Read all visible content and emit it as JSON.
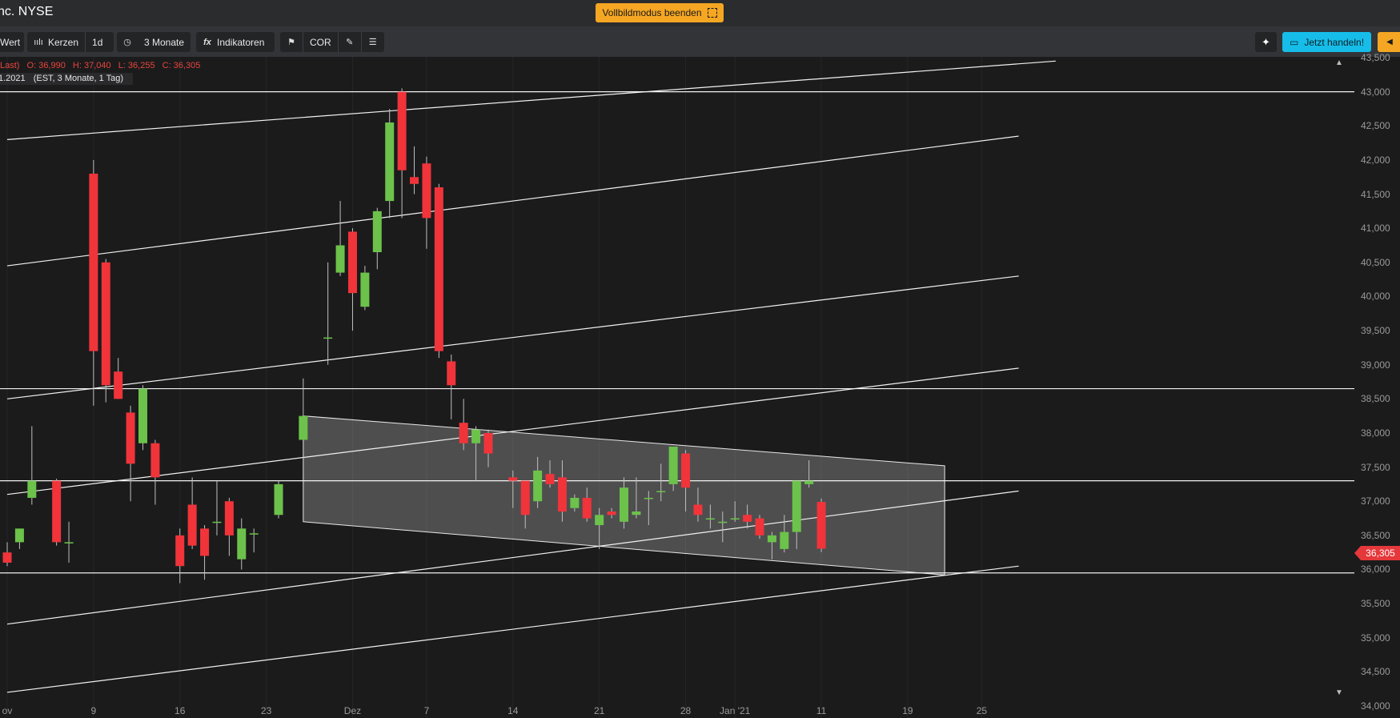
{
  "header": {
    "title": "nc. NYSE",
    "fullscreen_label": "Vollbildmodus beenden"
  },
  "toolbar": {
    "value_label": "Wert",
    "chart_type_label": "Kerzen",
    "interval_label": "1d",
    "period_label": "3 Monate",
    "indicators_label": "Indikatoren",
    "compare_label": "COR",
    "trade_label": "Jetzt handeln!"
  },
  "legend": {
    "price_type": "Last)",
    "open": "O: 36,990",
    "high": "H: 37,040",
    "low": "L: 36,255",
    "close": "C: 36,305",
    "date": "1.2021",
    "range": "(EST, 3 Monate, 1 Tag)"
  },
  "last_price_label": "36,305",
  "icons": {
    "candles": "candlestick-icon",
    "period": "clock-icon",
    "indicators": "fx-icon",
    "bookmark": "bookmark-icon",
    "draw": "pen-icon",
    "settings": "sliders-icon",
    "ai": "sparkle-icon",
    "trade": "ticket-icon",
    "collapse": "chevron-left-icon",
    "fullscreen": "exit-fullscreen-icon"
  },
  "colors": {
    "up": "#6cc24a",
    "down": "#f0343a",
    "accent": "#f5a623",
    "trade": "#16bde8"
  },
  "chart_data": {
    "type": "candlestick",
    "ylim": [
      34000,
      43500
    ],
    "y_ticks": [
      "34,000",
      "34,500",
      "35,000",
      "35,500",
      "36,000",
      "36,500",
      "37,000",
      "37,500",
      "38,000",
      "38,500",
      "39,000",
      "39,500",
      "40,000",
      "40,500",
      "41,000",
      "41,500",
      "42,000",
      "42,500",
      "43,000",
      "43,500"
    ],
    "x_ticks": [
      {
        "label": "ov",
        "day": 0
      },
      {
        "label": "9",
        "day": 7
      },
      {
        "label": "16",
        "day": 14
      },
      {
        "label": "23",
        "day": 21
      },
      {
        "label": "Dez",
        "day": 28
      },
      {
        "label": "7",
        "day": 34
      },
      {
        "label": "14",
        "day": 41
      },
      {
        "label": "21",
        "day": 48
      },
      {
        "label": "28",
        "day": 55
      },
      {
        "label": "Jan '21",
        "day": 59
      },
      {
        "label": "11",
        "day": 66
      },
      {
        "label": "19",
        "day": 73
      },
      {
        "label": "25",
        "day": 79
      }
    ],
    "candles": [
      {
        "day": 0,
        "o": 36.25,
        "h": 36.4,
        "l": 36.05,
        "c": 36.1
      },
      {
        "day": 1,
        "o": 36.4,
        "h": 36.6,
        "l": 36.3,
        "c": 36.6
      },
      {
        "day": 2,
        "o": 37.05,
        "h": 38.1,
        "l": 36.95,
        "c": 37.3
      },
      {
        "day": 4,
        "o": 37.3,
        "h": 37.33,
        "l": 36.35,
        "c": 36.4
      },
      {
        "day": 5,
        "o": 36.4,
        "h": 36.7,
        "l": 36.1,
        "c": 36.4
      },
      {
        "day": 7,
        "o": 41.8,
        "h": 42.0,
        "l": 38.4,
        "c": 39.2
      },
      {
        "day": 8,
        "o": 40.5,
        "h": 40.55,
        "l": 38.45,
        "c": 38.7
      },
      {
        "day": 9,
        "o": 38.9,
        "h": 39.1,
        "l": 38.5,
        "c": 38.5
      },
      {
        "day": 10,
        "o": 38.3,
        "h": 38.4,
        "l": 37.0,
        "c": 37.55
      },
      {
        "day": 11,
        "o": 37.85,
        "h": 38.7,
        "l": 37.75,
        "c": 38.65
      },
      {
        "day": 12,
        "o": 37.85,
        "h": 37.9,
        "l": 36.95,
        "c": 37.35
      },
      {
        "day": 14,
        "o": 36.5,
        "h": 36.6,
        "l": 35.8,
        "c": 36.05
      },
      {
        "day": 15,
        "o": 36.95,
        "h": 37.35,
        "l": 36.3,
        "c": 36.35
      },
      {
        "day": 16,
        "o": 36.6,
        "h": 36.65,
        "l": 35.85,
        "c": 36.2
      },
      {
        "day": 17,
        "o": 36.7,
        "h": 37.3,
        "l": 36.5,
        "c": 36.7
      },
      {
        "day": 18,
        "o": 37.0,
        "h": 37.05,
        "l": 36.2,
        "c": 36.5
      },
      {
        "day": 19,
        "o": 36.15,
        "h": 36.75,
        "l": 36.0,
        "c": 36.6
      },
      {
        "day": 20,
        "o": 36.53,
        "h": 36.6,
        "l": 36.25,
        "c": 36.53
      },
      {
        "day": 22,
        "o": 36.8,
        "h": 37.3,
        "l": 36.75,
        "c": 37.25
      },
      {
        "day": 24,
        "o": 37.9,
        "h": 38.8,
        "l": 37.6,
        "c": 38.25
      },
      {
        "day": 26,
        "o": 39.4,
        "h": 40.5,
        "l": 39.0,
        "c": 39.4
      },
      {
        "day": 27,
        "o": 40.35,
        "h": 41.4,
        "l": 40.3,
        "c": 40.75
      },
      {
        "day": 28,
        "o": 40.95,
        "h": 41.0,
        "l": 39.5,
        "c": 40.05
      },
      {
        "day": 29,
        "o": 39.85,
        "h": 40.45,
        "l": 39.8,
        "c": 40.35
      },
      {
        "day": 30,
        "o": 40.65,
        "h": 41.3,
        "l": 40.4,
        "c": 41.25
      },
      {
        "day": 31,
        "o": 41.4,
        "h": 42.75,
        "l": 41.15,
        "c": 42.55
      },
      {
        "day": 32,
        "o": 43.0,
        "h": 43.05,
        "l": 41.15,
        "c": 41.85
      },
      {
        "day": 33,
        "o": 41.75,
        "h": 42.2,
        "l": 41.5,
        "c": 41.65
      },
      {
        "day": 34,
        "o": 41.95,
        "h": 42.05,
        "l": 40.7,
        "c": 41.15
      },
      {
        "day": 35,
        "o": 41.6,
        "h": 41.65,
        "l": 39.1,
        "c": 39.2
      },
      {
        "day": 36,
        "o": 39.05,
        "h": 39.15,
        "l": 38.2,
        "c": 38.7
      },
      {
        "day": 37,
        "o": 38.15,
        "h": 38.5,
        "l": 37.75,
        "c": 37.85
      },
      {
        "day": 38,
        "o": 37.85,
        "h": 38.1,
        "l": 37.3,
        "c": 38.05
      },
      {
        "day": 39,
        "o": 38.0,
        "h": 38.05,
        "l": 37.5,
        "c": 37.7
      },
      {
        "day": 41,
        "o": 37.35,
        "h": 37.45,
        "l": 36.9,
        "c": 37.3
      },
      {
        "day": 42,
        "o": 37.3,
        "h": 37.3,
        "l": 36.6,
        "c": 36.8
      },
      {
        "day": 43,
        "o": 37.0,
        "h": 37.65,
        "l": 36.9,
        "c": 37.45
      },
      {
        "day": 44,
        "o": 37.4,
        "h": 37.6,
        "l": 37.2,
        "c": 37.25
      },
      {
        "day": 45,
        "o": 37.35,
        "h": 37.6,
        "l": 36.7,
        "c": 36.85
      },
      {
        "day": 46,
        "o": 36.9,
        "h": 37.1,
        "l": 36.85,
        "c": 37.05
      },
      {
        "day": 47,
        "o": 37.05,
        "h": 37.2,
        "l": 36.7,
        "c": 36.75
      },
      {
        "day": 48,
        "o": 36.65,
        "h": 36.9,
        "l": 36.3,
        "c": 36.8
      },
      {
        "day": 49,
        "o": 36.85,
        "h": 36.9,
        "l": 36.75,
        "c": 36.8
      },
      {
        "day": 50,
        "o": 36.7,
        "h": 37.35,
        "l": 36.6,
        "c": 37.2
      },
      {
        "day": 51,
        "o": 36.8,
        "h": 37.35,
        "l": 36.75,
        "c": 36.85
      },
      {
        "day": 52,
        "o": 37.05,
        "h": 37.15,
        "l": 36.65,
        "c": 37.05
      },
      {
        "day": 53,
        "o": 37.15,
        "h": 37.55,
        "l": 37.0,
        "c": 37.15
      },
      {
        "day": 54,
        "o": 37.25,
        "h": 37.8,
        "l": 37.15,
        "c": 37.8
      },
      {
        "day": 55,
        "o": 37.7,
        "h": 37.75,
        "l": 36.85,
        "c": 37.2
      },
      {
        "day": 56,
        "o": 36.95,
        "h": 37.2,
        "l": 36.7,
        "c": 36.8
      },
      {
        "day": 57,
        "o": 36.75,
        "h": 36.95,
        "l": 36.6,
        "c": 36.75
      },
      {
        "day": 58,
        "o": 36.7,
        "h": 36.85,
        "l": 36.4,
        "c": 36.7
      },
      {
        "day": 59,
        "o": 36.75,
        "h": 37.0,
        "l": 36.7,
        "c": 36.75
      },
      {
        "day": 60,
        "o": 36.8,
        "h": 36.95,
        "l": 36.6,
        "c": 36.7
      },
      {
        "day": 61,
        "o": 36.75,
        "h": 36.8,
        "l": 36.45,
        "c": 36.5
      },
      {
        "day": 62,
        "o": 36.4,
        "h": 36.55,
        "l": 36.15,
        "c": 36.5
      },
      {
        "day": 63,
        "o": 36.3,
        "h": 36.8,
        "l": 36.25,
        "c": 36.55
      },
      {
        "day": 64,
        "o": 36.55,
        "h": 37.3,
        "l": 36.3,
        "c": 37.3
      },
      {
        "day": 65,
        "o": 37.25,
        "h": 37.6,
        "l": 37.2,
        "c": 37.3
      },
      {
        "day": 66,
        "o": 36.99,
        "h": 37.04,
        "l": 36.255,
        "c": 36.305
      }
    ],
    "horizontal_lines": [
      43.0,
      38.65,
      37.3,
      35.95
    ],
    "channel_lines": [
      {
        "d1": 0,
        "v1": 42.3,
        "d2": 85,
        "v2": 43.45
      },
      {
        "d1": 0,
        "v1": 40.45,
        "d2": 82,
        "v2": 42.35
      },
      {
        "d1": 0,
        "v1": 38.5,
        "d2": 82,
        "v2": 40.3
      },
      {
        "d1": 0,
        "v1": 37.1,
        "d2": 82,
        "v2": 38.95
      },
      {
        "d1": 0,
        "v1": 35.2,
        "d2": 82,
        "v2": 37.15
      },
      {
        "d1": 0,
        "v1": 34.2,
        "d2": 82,
        "v2": 36.05
      }
    ],
    "range_box": {
      "d1": 24,
      "top1": 38.25,
      "bot1": 36.7,
      "d2": 76,
      "top2": 37.52,
      "bot2": 35.92
    }
  }
}
